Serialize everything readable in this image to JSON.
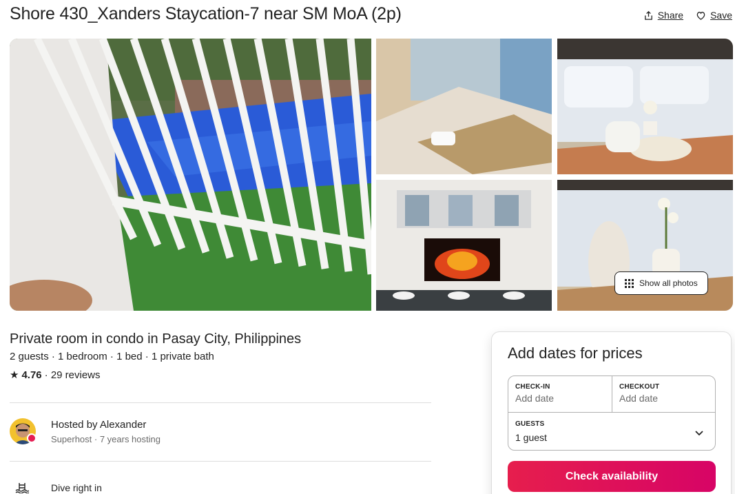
{
  "listing": {
    "title": "Shore 430_Xanders Staycation-7 near SM MoA (2p)",
    "subtitle": "Private room in condo in Pasay City, Philippines",
    "details": "2 guests · 1 bedroom · 1 bed · 1 private bath",
    "rating": "4.76",
    "reviews": "· 29 reviews"
  },
  "actions": {
    "share_label": "Share",
    "save_label": "Save"
  },
  "gallery": {
    "show_all_label": "Show all photos"
  },
  "host": {
    "name": "Hosted by Alexander",
    "sub": "Superhost · 7 years hosting"
  },
  "highlights": [
    {
      "title": "Dive right in",
      "icon": "pool-icon"
    }
  ],
  "booking": {
    "title": "Add dates for prices",
    "checkin_label": "CHECK-IN",
    "checkin_value": "Add date",
    "checkout_label": "CHECKOUT",
    "checkout_value": "Add date",
    "guests_label": "GUESTS",
    "guests_value": "1 guest",
    "button_label": "Check availability"
  },
  "colors": {
    "accent": "#e61e4d",
    "accent_end": "#d70466",
    "muted_text": "#6a6a6a",
    "border": "#dddddd"
  }
}
